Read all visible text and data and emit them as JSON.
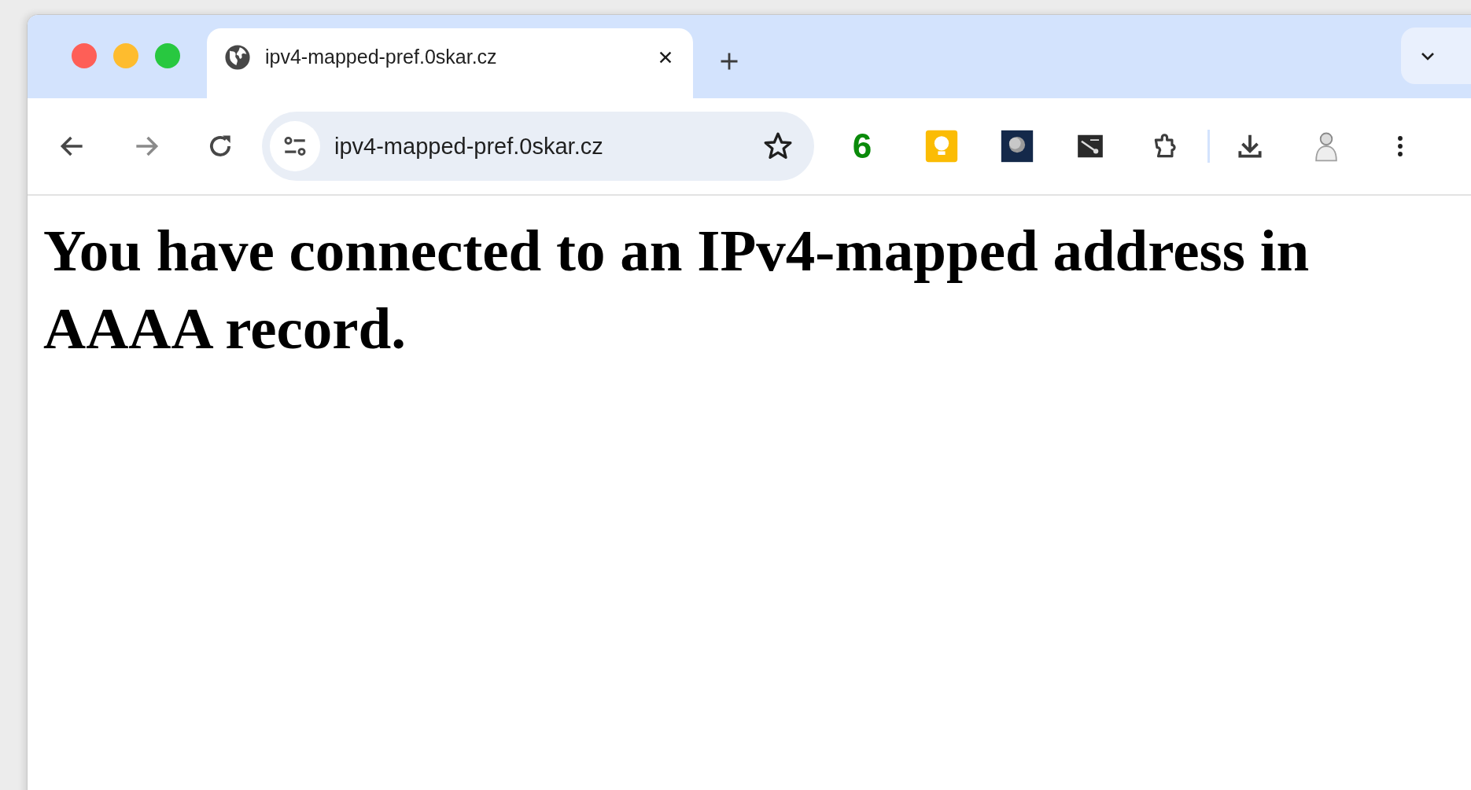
{
  "tabs": [
    {
      "title": "ipv4-mapped-pref.0skar.cz",
      "selected": true
    }
  ],
  "address_bar": {
    "url": "ipv4-mapped-pref.0skar.cz"
  },
  "extension_badge": "6",
  "page": {
    "heading": "You have connected to an IPv4-mapped address in AAAA record."
  }
}
